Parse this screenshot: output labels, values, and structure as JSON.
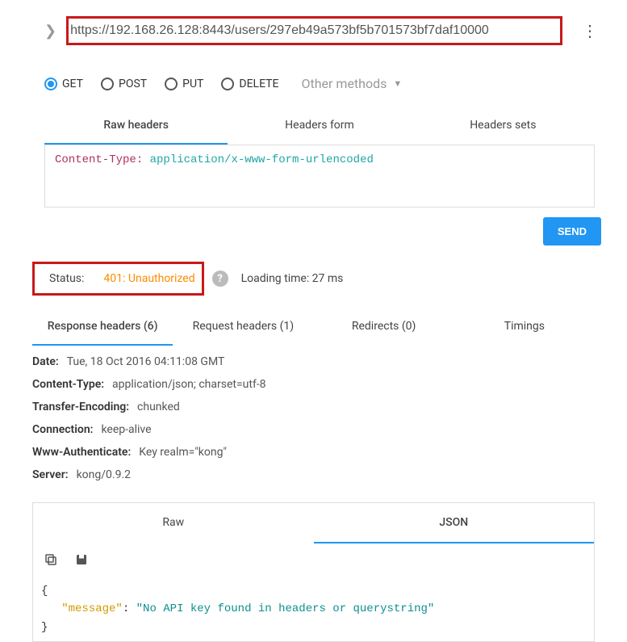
{
  "url": "https://192.168.26.128:8443/users/297eb49a573bf5b701573bf7daf10000",
  "methods": {
    "get": "GET",
    "post": "POST",
    "put": "PUT",
    "delete": "DELETE",
    "other": "Other methods"
  },
  "headerTabs": {
    "raw": "Raw headers",
    "form": "Headers form",
    "sets": "Headers sets"
  },
  "rawHeaders": {
    "key": "Content-Type: ",
    "value": "application/x-www-form-urlencoded"
  },
  "send": "SEND",
  "status": {
    "label": "Status:",
    "value": "401: Unauthorized"
  },
  "loading": "Loading time: 27 ms",
  "respTabs": {
    "respHeaders": "Response headers (6)",
    "reqHeaders": "Request headers (1)",
    "redirects": "Redirects (0)",
    "timings": "Timings"
  },
  "headers": [
    {
      "k": "Date:",
      "v": "Tue, 18 Oct 2016 04:11:08 GMT"
    },
    {
      "k": "Content-Type:",
      "v": "application/json; charset=utf-8"
    },
    {
      "k": "Transfer-Encoding:",
      "v": "chunked"
    },
    {
      "k": "Connection:",
      "v": "keep-alive"
    },
    {
      "k": "Www-Authenticate:",
      "v": "Key realm=\"kong\""
    },
    {
      "k": "Server:",
      "v": "kong/0.9.2"
    }
  ],
  "bodyTabs": {
    "raw": "Raw",
    "json": "JSON"
  },
  "json": {
    "key": "\"message\"",
    "sep": ": ",
    "val": "\"No API key found in headers or querystring\""
  }
}
